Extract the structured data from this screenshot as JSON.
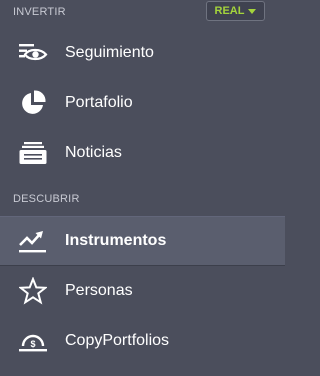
{
  "sections": {
    "invertir": {
      "header": "INVERTIR",
      "items": [
        {
          "label": "Seguimiento",
          "icon": "eye-list-icon"
        },
        {
          "label": "Portafolio",
          "icon": "pie-chart-icon"
        },
        {
          "label": "Noticias",
          "icon": "news-tray-icon"
        }
      ]
    },
    "descubrir": {
      "header": "DESCUBRIR",
      "items": [
        {
          "label": "Instrumentos",
          "icon": "trending-up-icon",
          "active": true
        },
        {
          "label": "Personas",
          "icon": "star-icon"
        },
        {
          "label": "CopyPortfolios",
          "icon": "gauge-icon"
        }
      ]
    }
  },
  "mode_badge": {
    "label": "REAL"
  },
  "colors": {
    "background": "#4b4e5c",
    "active_background": "#5a5e6e",
    "badge_text": "#a4d43c",
    "header_text": "#c8cad3"
  }
}
